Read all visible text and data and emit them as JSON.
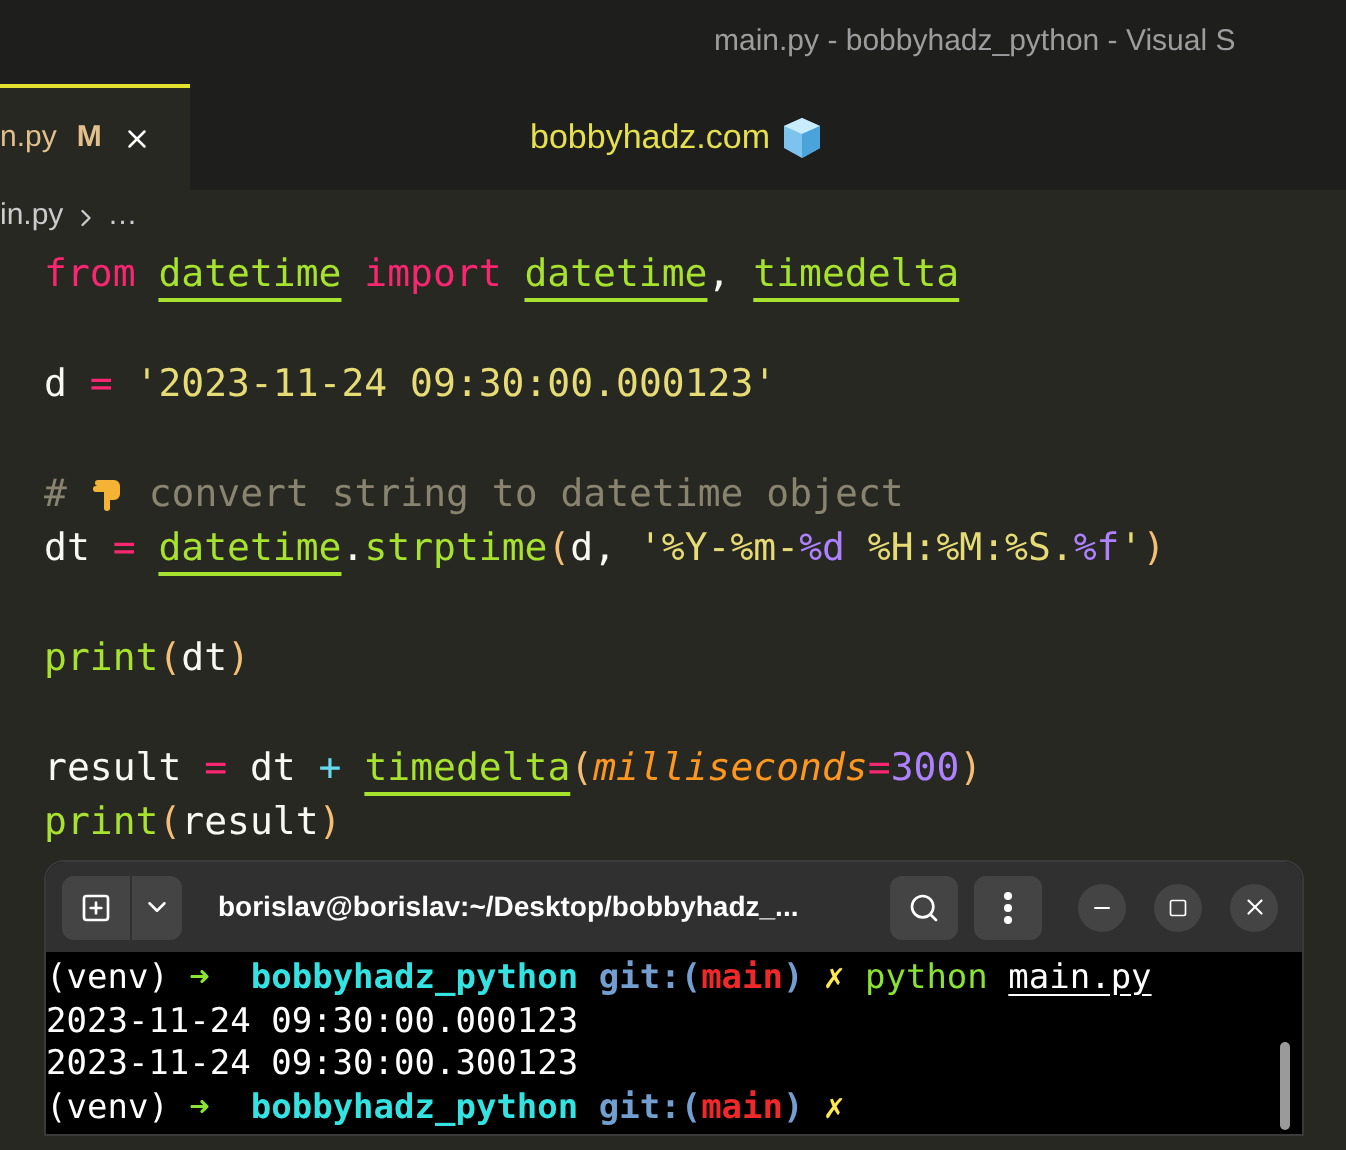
{
  "window": {
    "title": "main.py - bobbyhadz_python - Visual S"
  },
  "tabs": [
    {
      "label": "n.py",
      "badge": "M",
      "selected": true
    }
  ],
  "tab_bar_text": "bobbyhadz.com",
  "breadcrumb": {
    "file": "in.py",
    "more": "…"
  },
  "code": [
    {
      "kind": "code",
      "tokens": [
        {
          "kind": "keyword",
          "text": "from "
        },
        {
          "kind": "module",
          "text": "datetime"
        },
        {
          "kind": "keyword",
          "text": " import "
        },
        {
          "kind": "module",
          "text": "datetime"
        },
        {
          "kind": "plain",
          "text": ", "
        },
        {
          "kind": "module",
          "text": "timedelta"
        }
      ]
    },
    {
      "kind": "blank"
    },
    {
      "kind": "code",
      "tokens": [
        {
          "kind": "plain",
          "text": "d "
        },
        {
          "kind": "op",
          "text": "="
        },
        {
          "kind": "string",
          "text": " '2023-11-24 09:30:00.000123'"
        }
      ]
    },
    {
      "kind": "blank"
    },
    {
      "kind": "code",
      "tokens": [
        {
          "kind": "comment",
          "text": "# "
        },
        {
          "kind": "emoji"
        },
        {
          "kind": "comment",
          "text": " convert string to datetime object"
        }
      ]
    },
    {
      "kind": "code",
      "tokens": [
        {
          "kind": "plain",
          "text": "dt "
        },
        {
          "kind": "op",
          "text": "= "
        },
        {
          "kind": "module",
          "text": "datetime"
        },
        {
          "kind": "plain",
          "text": "."
        },
        {
          "kind": "func",
          "text": "strptime"
        },
        {
          "kind": "paren",
          "text": "("
        },
        {
          "kind": "plain",
          "text": "d, "
        },
        {
          "kind": "string",
          "text": "'%Y-%m-"
        },
        {
          "kind": "fmt",
          "text": "%d"
        },
        {
          "kind": "string",
          "text": " %H:%M:%S."
        },
        {
          "kind": "fmt",
          "text": "%f"
        },
        {
          "kind": "string",
          "text": "'"
        },
        {
          "kind": "paren",
          "text": ")"
        }
      ]
    },
    {
      "kind": "blank"
    },
    {
      "kind": "code",
      "tokens": [
        {
          "kind": "func",
          "text": "print"
        },
        {
          "kind": "paren",
          "text": "("
        },
        {
          "kind": "plain",
          "text": "dt"
        },
        {
          "kind": "paren",
          "text": ")"
        }
      ]
    },
    {
      "kind": "blank"
    },
    {
      "kind": "code",
      "tokens": [
        {
          "kind": "plain",
          "text": "result "
        },
        {
          "kind": "op",
          "text": "= "
        },
        {
          "kind": "plain",
          "text": "dt "
        },
        {
          "kind": "plus",
          "text": "+ "
        },
        {
          "kind": "module",
          "text": "timedelta"
        },
        {
          "kind": "paren",
          "text": "("
        },
        {
          "kind": "param",
          "text": "milliseconds"
        },
        {
          "kind": "op",
          "text": "="
        },
        {
          "kind": "number",
          "text": "300"
        },
        {
          "kind": "paren",
          "text": ")"
        }
      ]
    },
    {
      "kind": "code",
      "tokens": [
        {
          "kind": "func",
          "text": "print"
        },
        {
          "kind": "paren",
          "text": "("
        },
        {
          "kind": "plain",
          "text": "result"
        },
        {
          "kind": "paren",
          "text": ")"
        }
      ]
    }
  ],
  "terminal": {
    "title": "borislav@borislav:~/Desktop/bobbyhadz_...",
    "lines": [
      {
        "tokens": [
          {
            "kind": "plain",
            "text": "(venv) "
          },
          {
            "kind": "arrow",
            "text": "➜  "
          },
          {
            "kind": "dir",
            "text": "bobbyhadz_python "
          },
          {
            "kind": "git",
            "text": "git:("
          },
          {
            "kind": "branch",
            "text": "main"
          },
          {
            "kind": "git",
            "text": ") "
          },
          {
            "kind": "dirty",
            "text": "✗ "
          },
          {
            "kind": "cmd",
            "text": "python "
          },
          {
            "kind": "file",
            "text": "main.py"
          }
        ]
      },
      {
        "tokens": [
          {
            "kind": "plain",
            "text": "2023-11-24 09:30:00.000123"
          }
        ]
      },
      {
        "tokens": [
          {
            "kind": "plain",
            "text": "2023-11-24 09:30:00.300123"
          }
        ]
      },
      {
        "tokens": [
          {
            "kind": "plain",
            "text": "(venv) "
          },
          {
            "kind": "arrow",
            "text": "➜  "
          },
          {
            "kind": "dir",
            "text": "bobbyhadz_python "
          },
          {
            "kind": "git",
            "text": "git:("
          },
          {
            "kind": "branch",
            "text": "main"
          },
          {
            "kind": "git",
            "text": ") "
          },
          {
            "kind": "dirty",
            "text": "✗"
          }
        ]
      }
    ]
  }
}
